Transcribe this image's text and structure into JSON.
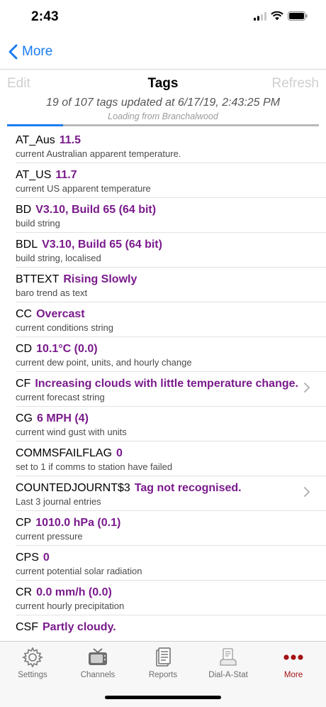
{
  "status_bar": {
    "time": "2:43"
  },
  "nav": {
    "back_label": "More"
  },
  "toolbar": {
    "edit_label": "Edit",
    "title": "Tags",
    "refresh_label": "Refresh"
  },
  "status": {
    "update_text": "19 of 107 tags updated at 6/17/19, 2:43:25 PM",
    "loading_text": "Loading from Branchalwood",
    "progress": 0.18
  },
  "tags": [
    {
      "name": "AT_Aus",
      "value": "11.5",
      "description": "current Australian apparent temperature.",
      "has_detail": false
    },
    {
      "name": "AT_US",
      "value": "11.7",
      "description": "current US apparent temperature",
      "has_detail": false
    },
    {
      "name": "BD",
      "value": "V3.10, Build 65 (64 bit)",
      "description": "build string",
      "has_detail": false
    },
    {
      "name": "BDL",
      "value": "V3.10, Build 65 (64 bit)",
      "description": "build string, localised",
      "has_detail": false
    },
    {
      "name": "BTTEXT",
      "value": "Rising Slowly",
      "description": "baro trend as text",
      "has_detail": false
    },
    {
      "name": "CC",
      "value": "Overcast",
      "description": "current conditions string",
      "has_detail": false
    },
    {
      "name": "CD",
      "value": "10.1°C (0.0)",
      "description": "current dew point, units, and hourly change",
      "has_detail": false
    },
    {
      "name": "CF",
      "value": "Increasing clouds with little temperature change.",
      "description": "current forecast string",
      "has_detail": true
    },
    {
      "name": "CG",
      "value": "6 MPH (4)",
      "description": "current wind gust with units",
      "has_detail": false
    },
    {
      "name": "COMMSFAILFLAG",
      "value": "0",
      "description": "set to 1 if comms to station have failed",
      "has_detail": false
    },
    {
      "name": "COUNTEDJOURNT$3",
      "value": "Tag not recognised.",
      "description": "Last 3 journal entries",
      "has_detail": true
    },
    {
      "name": "CP",
      "value": "1010.0 hPa (0.1)",
      "description": "current pressure",
      "has_detail": false
    },
    {
      "name": "CPS",
      "value": "0",
      "description": "current potential solar radiation",
      "has_detail": false
    },
    {
      "name": "CR",
      "value": "0.0 mm/h (0.0)",
      "description": "current hourly precipitation",
      "has_detail": false
    },
    {
      "name": "CSF",
      "value": "Partly cloudy.",
      "description": "",
      "has_detail": false
    }
  ],
  "tabs": [
    {
      "label": "Settings",
      "icon": "gear-icon",
      "active": false
    },
    {
      "label": "Channels",
      "icon": "tv-icon",
      "active": false
    },
    {
      "label": "Reports",
      "icon": "document-icon",
      "active": false
    },
    {
      "label": "Dial-A-Stat",
      "icon": "phone-document-icon",
      "active": false
    },
    {
      "label": "More",
      "icon": "more-dots-icon",
      "active": true
    }
  ],
  "colors": {
    "accent": "#1a7cf2",
    "tag_value": "#7a1a8c",
    "active_tab": "#a31212"
  }
}
